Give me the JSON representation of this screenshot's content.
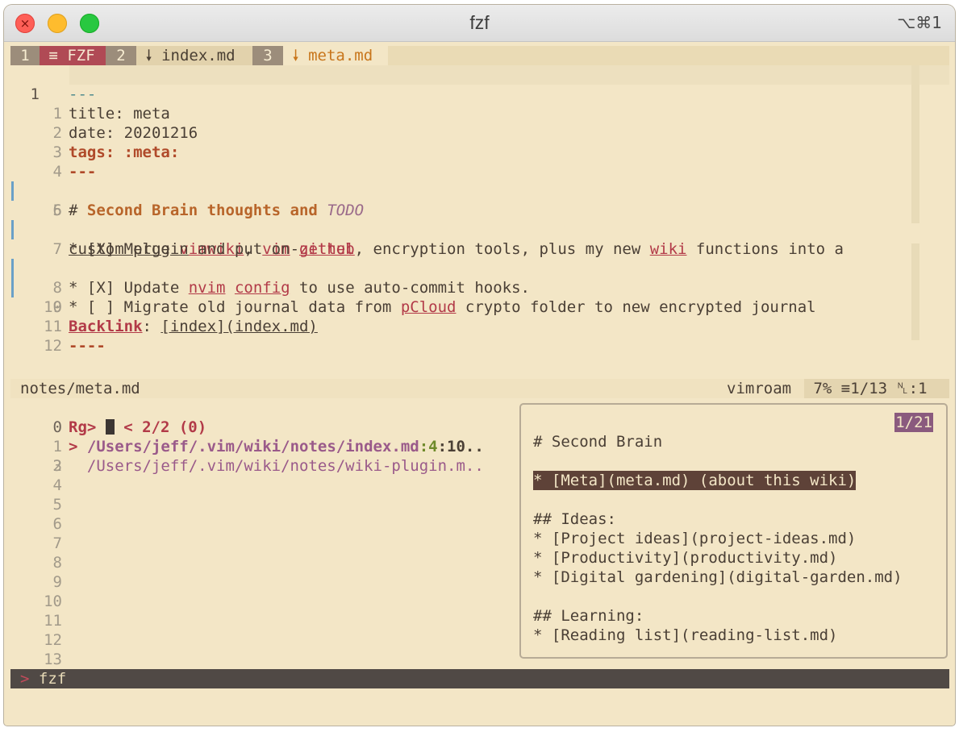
{
  "window": {
    "title": "fzf",
    "shortcut": "⌥⌘1",
    "close_glyph": "×"
  },
  "tabline": [
    {
      "num": "1",
      "icon": "list-icon",
      "icon_glyph": "≡",
      "label": "FZF"
    },
    {
      "num": "2",
      "icon": "markdown-icon",
      "icon_glyph": "🠗",
      "label": "index.md"
    },
    {
      "num": "3",
      "icon": "markdown-icon",
      "icon_glyph": "🠗",
      "label": "meta.md"
    }
  ],
  "editor": {
    "cursor_line_number": "1",
    "lines": [
      {
        "n": "",
        "text": "---"
      },
      {
        "n": "1",
        "text": "title: meta"
      },
      {
        "n": "2",
        "text": "date: 20201216"
      },
      {
        "n": "3",
        "key": "tags:",
        "val": " :meta:"
      },
      {
        "n": "4",
        "text": "---"
      },
      {
        "n": "5",
        "hash": "# ",
        "heading": "Second Brain thoughts and ",
        "todo": "TODO"
      },
      {
        "n": "6",
        "text": ""
      },
      {
        "n": "7",
        "t1": "* [X] Merge ",
        "l1": "vimwiki",
        "t2": ", ",
        "l2": "vim",
        "t3": "-",
        "l3": "zettel",
        "t4": ", encryption tools, plus my new ",
        "l4": "wiki",
        "t5": " functions into a"
      },
      {
        "n": "",
        "u1": "custom plugin",
        "t1": " and put on ",
        "l1": "github"
      },
      {
        "n": "8",
        "t1": "* [X] Update ",
        "l1": "nvim",
        "t2": " ",
        "l2": "config",
        "t3": " to use auto-commit hooks."
      },
      {
        "n": "9",
        "t1": "* [ ] Migrate old journal data from ",
        "l1": "pCloud",
        "t2": " crypto folder to new encrypted journal"
      },
      {
        "n": "10",
        "text": ""
      },
      {
        "n": "11",
        "b1": "Backlink",
        "t1": ": ",
        "u1": "[index](index.md)"
      },
      {
        "n": "12",
        "text": "----"
      }
    ]
  },
  "statusline": {
    "file": "notes/meta.md",
    "filetype": "vimroam",
    "percent": "7%",
    "lines_icon": "≡",
    "position": "1/13",
    "column_icon": "␤",
    "column": ":1"
  },
  "fzf": {
    "prompt_line_number": "0",
    "prompt": "Rg>",
    "info": "< 2/2 (0)",
    "results": [
      {
        "n": "1",
        "pointer": ">",
        "path": "/Users/jeff/.vim/wiki/notes/index.md",
        "line": ":4",
        "col": ":10..",
        "selected": true
      },
      {
        "n": "2",
        "pointer": "",
        "path": "/Users/jeff/.vim/wiki/notes/wiki-plugin.m..",
        "line": "",
        "col": "",
        "selected": false
      }
    ],
    "empty_line_numbers": [
      "3",
      "4",
      "5",
      "6",
      "7",
      "8",
      "9",
      "10",
      "11",
      "12",
      "13"
    ]
  },
  "preview": {
    "counter": "1/21",
    "lines": [
      "# Second Brain",
      "",
      "* [Meta](meta.md) (about this wiki)",
      "",
      "## Ideas:",
      "* [Project ideas](project-ideas.md)",
      "* [Productivity](productivity.md)",
      "* [Digital gardening](digital-garden.md)",
      "",
      "## Learning:",
      "* [Reading list](reading-list.md)"
    ]
  },
  "cmdline": {
    "prompt": ">",
    "text": "fzf"
  }
}
